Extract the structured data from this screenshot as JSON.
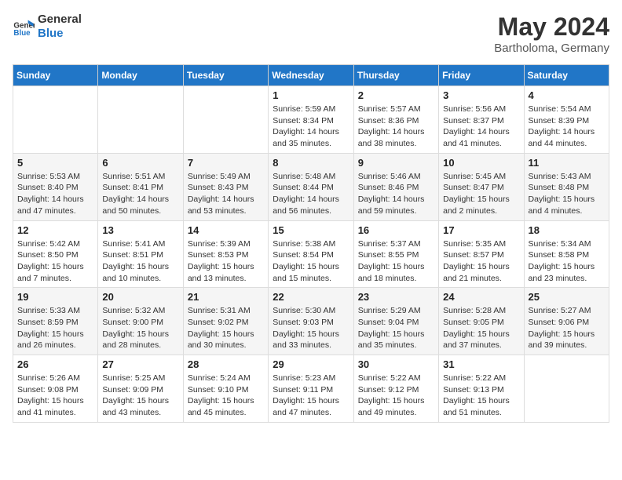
{
  "header": {
    "logo_line1": "General",
    "logo_line2": "Blue",
    "month_year": "May 2024",
    "location": "Bartholoma, Germany"
  },
  "days_of_week": [
    "Sunday",
    "Monday",
    "Tuesday",
    "Wednesday",
    "Thursday",
    "Friday",
    "Saturday"
  ],
  "weeks": [
    [
      {
        "day": "",
        "info": ""
      },
      {
        "day": "",
        "info": ""
      },
      {
        "day": "",
        "info": ""
      },
      {
        "day": "1",
        "info": "Sunrise: 5:59 AM\nSunset: 8:34 PM\nDaylight: 14 hours and 35 minutes."
      },
      {
        "day": "2",
        "info": "Sunrise: 5:57 AM\nSunset: 8:36 PM\nDaylight: 14 hours and 38 minutes."
      },
      {
        "day": "3",
        "info": "Sunrise: 5:56 AM\nSunset: 8:37 PM\nDaylight: 14 hours and 41 minutes."
      },
      {
        "day": "4",
        "info": "Sunrise: 5:54 AM\nSunset: 8:39 PM\nDaylight: 14 hours and 44 minutes."
      }
    ],
    [
      {
        "day": "5",
        "info": "Sunrise: 5:53 AM\nSunset: 8:40 PM\nDaylight: 14 hours and 47 minutes."
      },
      {
        "day": "6",
        "info": "Sunrise: 5:51 AM\nSunset: 8:41 PM\nDaylight: 14 hours and 50 minutes."
      },
      {
        "day": "7",
        "info": "Sunrise: 5:49 AM\nSunset: 8:43 PM\nDaylight: 14 hours and 53 minutes."
      },
      {
        "day": "8",
        "info": "Sunrise: 5:48 AM\nSunset: 8:44 PM\nDaylight: 14 hours and 56 minutes."
      },
      {
        "day": "9",
        "info": "Sunrise: 5:46 AM\nSunset: 8:46 PM\nDaylight: 14 hours and 59 minutes."
      },
      {
        "day": "10",
        "info": "Sunrise: 5:45 AM\nSunset: 8:47 PM\nDaylight: 15 hours and 2 minutes."
      },
      {
        "day": "11",
        "info": "Sunrise: 5:43 AM\nSunset: 8:48 PM\nDaylight: 15 hours and 4 minutes."
      }
    ],
    [
      {
        "day": "12",
        "info": "Sunrise: 5:42 AM\nSunset: 8:50 PM\nDaylight: 15 hours and 7 minutes."
      },
      {
        "day": "13",
        "info": "Sunrise: 5:41 AM\nSunset: 8:51 PM\nDaylight: 15 hours and 10 minutes."
      },
      {
        "day": "14",
        "info": "Sunrise: 5:39 AM\nSunset: 8:53 PM\nDaylight: 15 hours and 13 minutes."
      },
      {
        "day": "15",
        "info": "Sunrise: 5:38 AM\nSunset: 8:54 PM\nDaylight: 15 hours and 15 minutes."
      },
      {
        "day": "16",
        "info": "Sunrise: 5:37 AM\nSunset: 8:55 PM\nDaylight: 15 hours and 18 minutes."
      },
      {
        "day": "17",
        "info": "Sunrise: 5:35 AM\nSunset: 8:57 PM\nDaylight: 15 hours and 21 minutes."
      },
      {
        "day": "18",
        "info": "Sunrise: 5:34 AM\nSunset: 8:58 PM\nDaylight: 15 hours and 23 minutes."
      }
    ],
    [
      {
        "day": "19",
        "info": "Sunrise: 5:33 AM\nSunset: 8:59 PM\nDaylight: 15 hours and 26 minutes."
      },
      {
        "day": "20",
        "info": "Sunrise: 5:32 AM\nSunset: 9:00 PM\nDaylight: 15 hours and 28 minutes."
      },
      {
        "day": "21",
        "info": "Sunrise: 5:31 AM\nSunset: 9:02 PM\nDaylight: 15 hours and 30 minutes."
      },
      {
        "day": "22",
        "info": "Sunrise: 5:30 AM\nSunset: 9:03 PM\nDaylight: 15 hours and 33 minutes."
      },
      {
        "day": "23",
        "info": "Sunrise: 5:29 AM\nSunset: 9:04 PM\nDaylight: 15 hours and 35 minutes."
      },
      {
        "day": "24",
        "info": "Sunrise: 5:28 AM\nSunset: 9:05 PM\nDaylight: 15 hours and 37 minutes."
      },
      {
        "day": "25",
        "info": "Sunrise: 5:27 AM\nSunset: 9:06 PM\nDaylight: 15 hours and 39 minutes."
      }
    ],
    [
      {
        "day": "26",
        "info": "Sunrise: 5:26 AM\nSunset: 9:08 PM\nDaylight: 15 hours and 41 minutes."
      },
      {
        "day": "27",
        "info": "Sunrise: 5:25 AM\nSunset: 9:09 PM\nDaylight: 15 hours and 43 minutes."
      },
      {
        "day": "28",
        "info": "Sunrise: 5:24 AM\nSunset: 9:10 PM\nDaylight: 15 hours and 45 minutes."
      },
      {
        "day": "29",
        "info": "Sunrise: 5:23 AM\nSunset: 9:11 PM\nDaylight: 15 hours and 47 minutes."
      },
      {
        "day": "30",
        "info": "Sunrise: 5:22 AM\nSunset: 9:12 PM\nDaylight: 15 hours and 49 minutes."
      },
      {
        "day": "31",
        "info": "Sunrise: 5:22 AM\nSunset: 9:13 PM\nDaylight: 15 hours and 51 minutes."
      },
      {
        "day": "",
        "info": ""
      }
    ]
  ]
}
